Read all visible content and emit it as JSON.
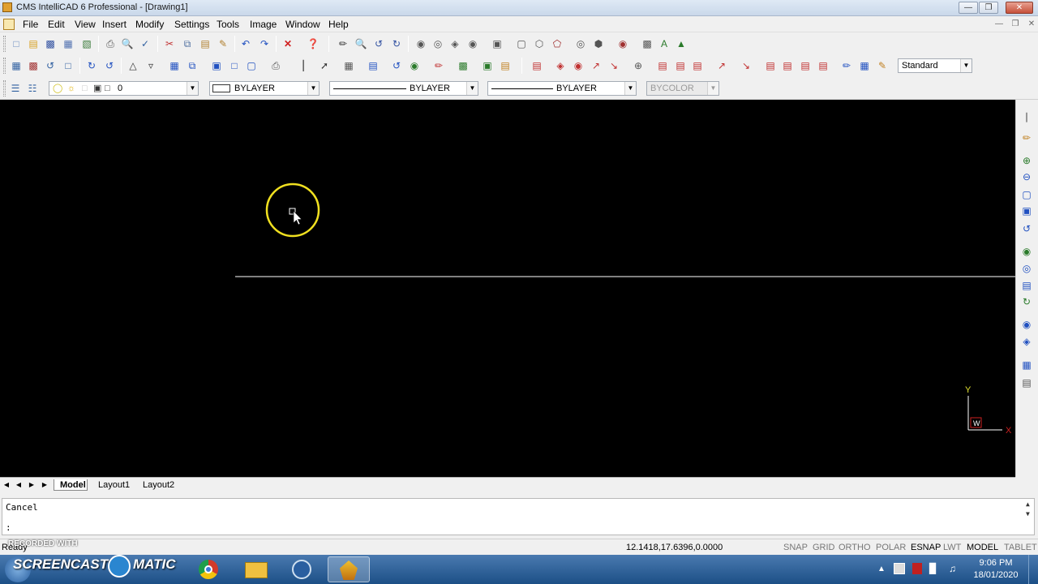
{
  "window": {
    "title": "CMS IntelliCAD 6 Professional - [Drawing1]",
    "controls": [
      "minimize",
      "restore",
      "close"
    ]
  },
  "menubar": {
    "items": [
      "File",
      "Edit",
      "View",
      "Insert",
      "Modify",
      "Settings",
      "Tools",
      "Image",
      "Window",
      "Help"
    ]
  },
  "toolbar3": {
    "layer_value": "0",
    "color_value": "BYLAYER",
    "linetype_value": "BYLAYER",
    "lineweight_value": "BYLAYER",
    "plotstyle_value": "BYCOLOR"
  },
  "toolbar2": {
    "textstyle_value": "Standard"
  },
  "canvas": {
    "background": "#000000",
    "ucs": {
      "y_label": "Y",
      "x_label": "X",
      "origin_label": "W"
    }
  },
  "tabs": {
    "items": [
      "Model",
      "Layout1",
      "Layout2"
    ],
    "active": "Model"
  },
  "command": {
    "history_line": "Cancel",
    "prompt": ":"
  },
  "status": {
    "left_text": "Ready",
    "coordinates": "12.1418,17.6396,0.0000",
    "toggles": [
      "SNAP",
      "GRID",
      "ORTHO",
      "POLAR",
      "ESNAP",
      "LWT",
      "MODEL",
      "TABLET"
    ],
    "active_toggles": [
      "ESNAP",
      "MODEL"
    ]
  },
  "watermark": {
    "top_text": "RECORDED WITH",
    "brand_left": "SCREENCAST",
    "brand_right": "MATIC"
  },
  "taskbar": {
    "time": "9:06 PM",
    "date": "18/01/2020"
  },
  "colors": {
    "cursor_highlight": "#f0e020",
    "accent_red": "#cc2020"
  }
}
